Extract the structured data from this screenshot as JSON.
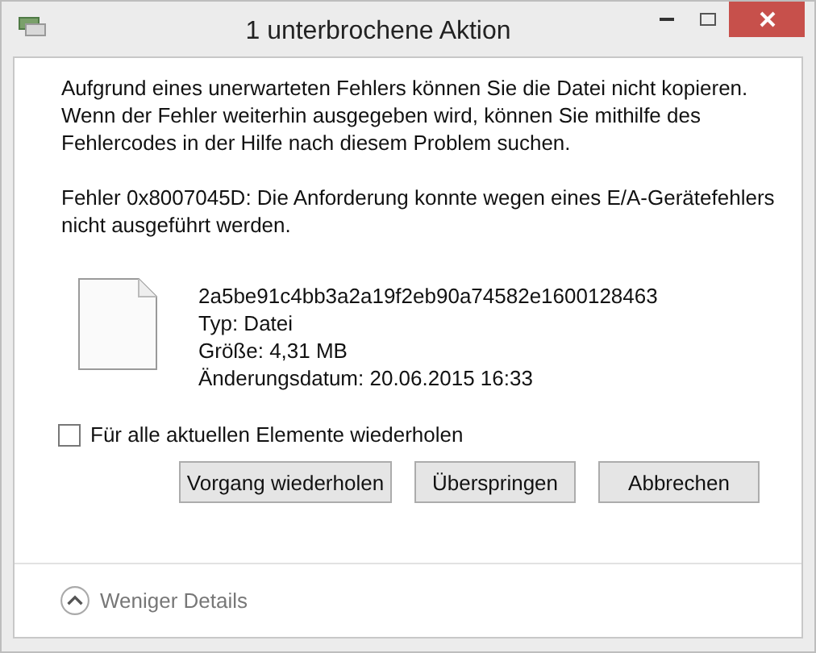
{
  "window": {
    "title": "1 unterbrochene Aktion"
  },
  "message": [
    "Aufgrund eines unerwarteten Fehlers können Sie die Datei nicht kopieren. Wenn der Fehler weiterhin ausgegeben wird, können Sie mithilfe des Fehlercodes in der Hilfe nach diesem Problem suchen.",
    "Fehler 0x8007045D: Die Anforderung konnte wegen eines E/A-Gerätefehlers nicht ausgeführt werden."
  ],
  "file": {
    "name": "2a5be91c4bb3a2a19f2eb90a74582e1600128463",
    "details": [
      "Typ: Datei",
      "Größe: 4,31 MB",
      "Änderungsdatum: 20.06.2015 16:33"
    ]
  },
  "repeat_checkbox": {
    "label": "Für alle aktuellen Elemente wiederholen",
    "checked": false
  },
  "buttons": [
    "Vorgang wiederholen",
    "Überspringen",
    "Abbrechen"
  ],
  "details_toggle": {
    "label": "Weniger Details",
    "expanded": true
  }
}
